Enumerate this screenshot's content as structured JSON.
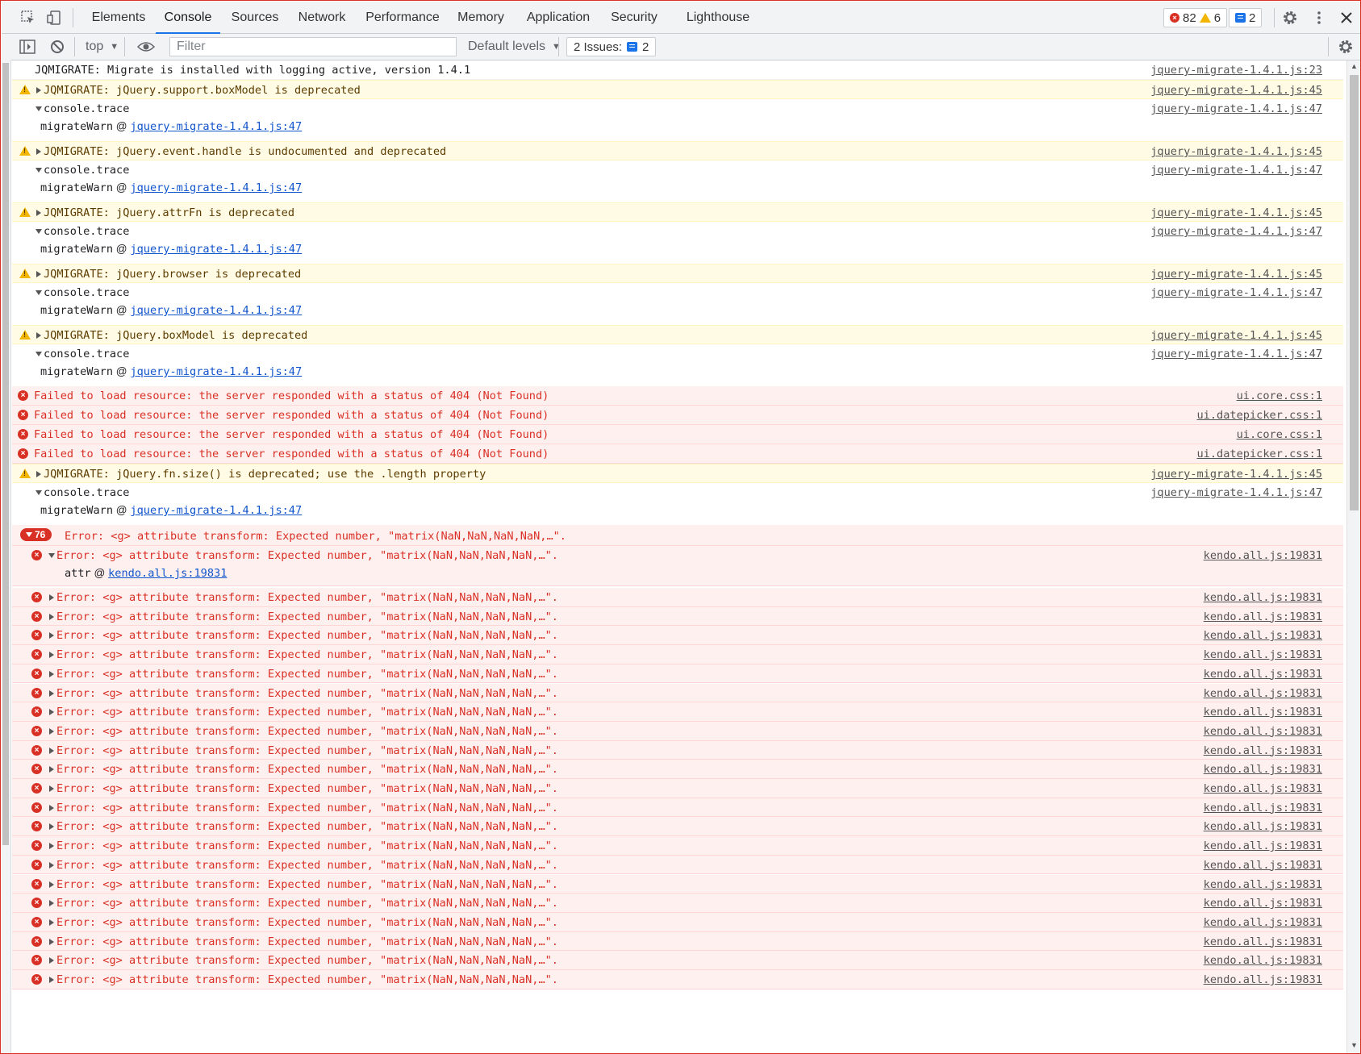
{
  "tabs": [
    "Elements",
    "Console",
    "Sources",
    "Network",
    "Performance",
    "Memory",
    "Application",
    "Security",
    "Lighthouse"
  ],
  "active_tab": "Console",
  "counts": {
    "errors": "82",
    "warnings": "6",
    "messages": "2"
  },
  "toolbar": {
    "context": "top",
    "filter_placeholder": "Filter",
    "levels": "Default levels",
    "issues_label": "2 Issues:",
    "issues_count": "2"
  },
  "log": {
    "info_text": "JQMIGRATE: Migrate is installed with logging active, version 1.4.1",
    "info_src": "jquery-migrate-1.4.1.js:23",
    "warn_src": "jquery-migrate-1.4.1.js:45",
    "trace_src": "jquery-migrate-1.4.1.js:47",
    "trace_label": "console.trace",
    "trace_fn": "migrateWarn",
    "trace_link": "jquery-migrate-1.4.1.js:47",
    "warnings": [
      "JQMIGRATE: jQuery.support.boxModel is deprecated",
      "JQMIGRATE: jQuery.event.handle is undocumented and deprecated",
      "JQMIGRATE: jQuery.attrFn is deprecated",
      "JQMIGRATE: jQuery.browser is deprecated",
      "JQMIGRATE: jQuery.boxModel is deprecated"
    ],
    "failed_text": "Failed to load resource: the server responded with a status of 404 (Not Found)",
    "failed_sources": [
      "ui.core.css:1",
      "ui.datepicker.css:1",
      "ui.core.css:1",
      "ui.datepicker.css:1"
    ],
    "warn_size": "JQMIGRATE: jQuery.fn.size() is deprecated; use the .length property",
    "group_count": "76",
    "group_text": "Error: <g> attribute transform: Expected number, \"matrix(NaN,NaN,NaN,NaN,…\".",
    "error_text": "Error: <g> attribute transform: Expected number, \"matrix(NaN,NaN,NaN,NaN,…\".",
    "error_src": "kendo.all.js:19831",
    "attr_fn": "attr",
    "attr_link": "kendo.all.js:19831",
    "repeat_errors": 21
  },
  "colors": {
    "accent": "#1a73e8",
    "error": "#d93025",
    "warning": "#f2b600"
  }
}
